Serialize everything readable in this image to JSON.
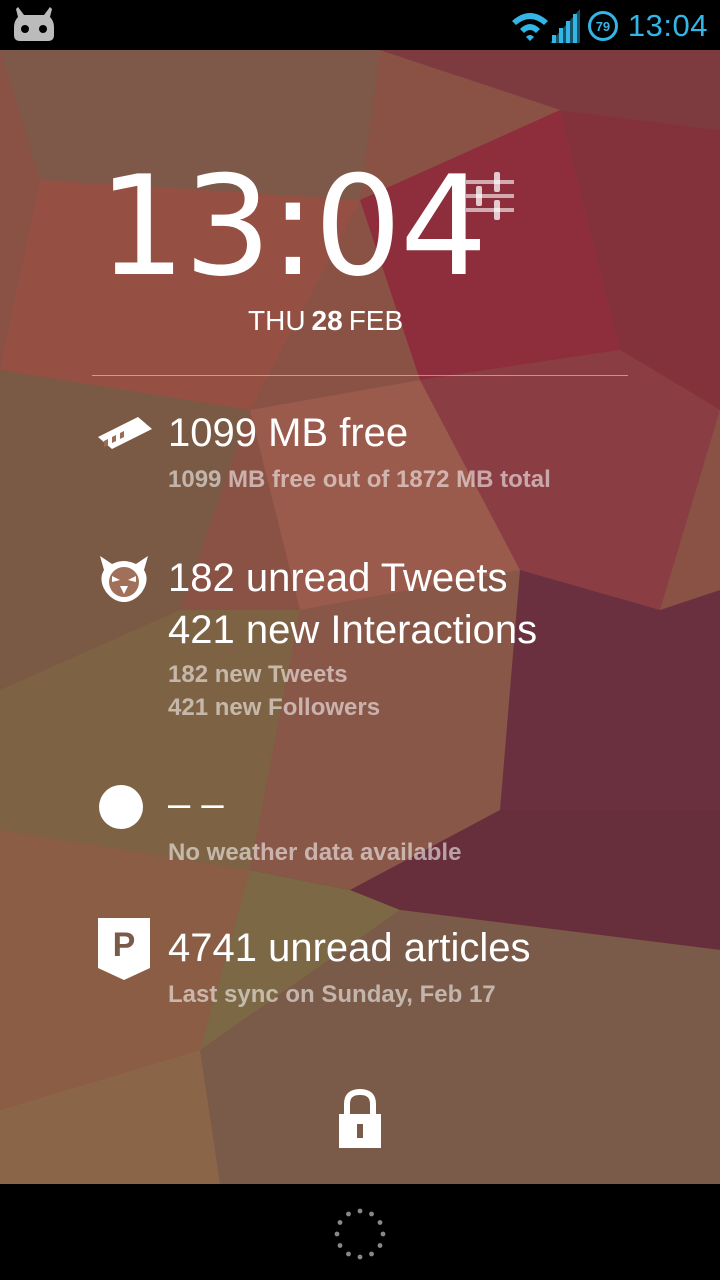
{
  "status_bar": {
    "time": "13:04",
    "battery_level": "79",
    "icons": [
      "cyanogenmod-icon",
      "wifi-icon",
      "signal-icon",
      "battery-icon"
    ],
    "accent_color": "#33b5e5"
  },
  "lockscreen": {
    "time": "13:04",
    "date": {
      "day": "THU",
      "number": "28",
      "month": "FEB"
    },
    "settings_icon": "sliders-icon"
  },
  "extensions": [
    {
      "icon": "memory-card-icon",
      "title": "1099 MB free",
      "subtitle": "1099 MB free out of 1872 MB total"
    },
    {
      "icon": "falcon-icon",
      "title": "182 unread Tweets",
      "title2": "421 new Interactions",
      "subtitle": "182 new Tweets",
      "subtitle2": "421 new Followers"
    },
    {
      "icon": "weather-dot-icon",
      "title": "– –",
      "subtitle": "No weather data available"
    },
    {
      "icon": "pocket-icon",
      "title": "4741 unread articles",
      "subtitle": "Last sync on Sunday, Feb 17"
    }
  ],
  "unlock": {
    "icon": "lock-icon"
  },
  "nav": {
    "icon": "loading-ring-icon"
  }
}
